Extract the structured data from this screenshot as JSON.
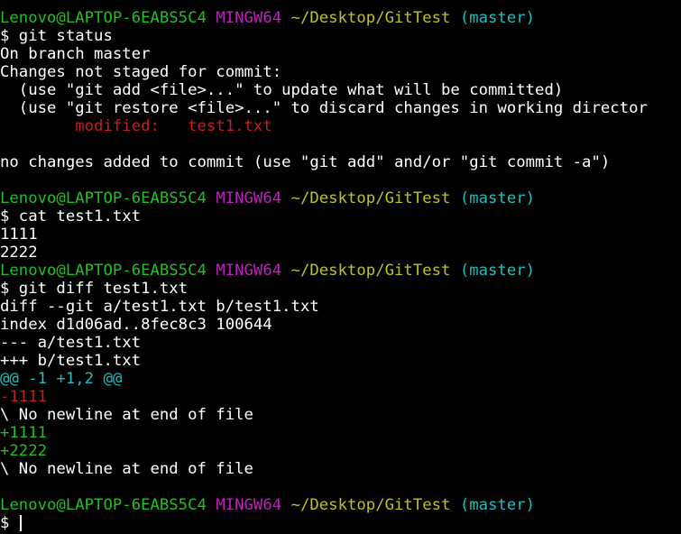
{
  "colors": {
    "background": "#000000",
    "default": "#ffffff",
    "green": "#1fc21f",
    "magenta": "#c01fc0",
    "yellow": "#c0c01f",
    "cyan": "#1fbfbf",
    "red": "#c01f1f"
  },
  "prompt": {
    "user_host": "Lenovo@LAPTOP-6EABS5C4",
    "shell": "MINGW64",
    "path": "~/Desktop/GitTest",
    "branch": "(master)"
  },
  "lines": [
    "$ git status",
    "On branch master",
    "Changes not staged for commit:",
    "  (use \"git add <file>...\" to update what will be committed)",
    "  (use \"git restore <file>...\" to discard changes in working director",
    "        modified:   test1.txt",
    "no changes added to commit (use \"git add\" and/or \"git commit -a\")",
    "$ cat test1.txt",
    "1111",
    "2222",
    "$ git diff test1.txt",
    "diff --git a/test1.txt b/test1.txt",
    "index d1d06ad..8fec8c3 100644",
    "--- a/test1.txt",
    "+++ b/test1.txt",
    "@@ -1 +1,2 @@",
    "-1111",
    "\\ No newline at end of file",
    "+1111",
    "+2222",
    "\\ No newline at end of file",
    "$ "
  ]
}
